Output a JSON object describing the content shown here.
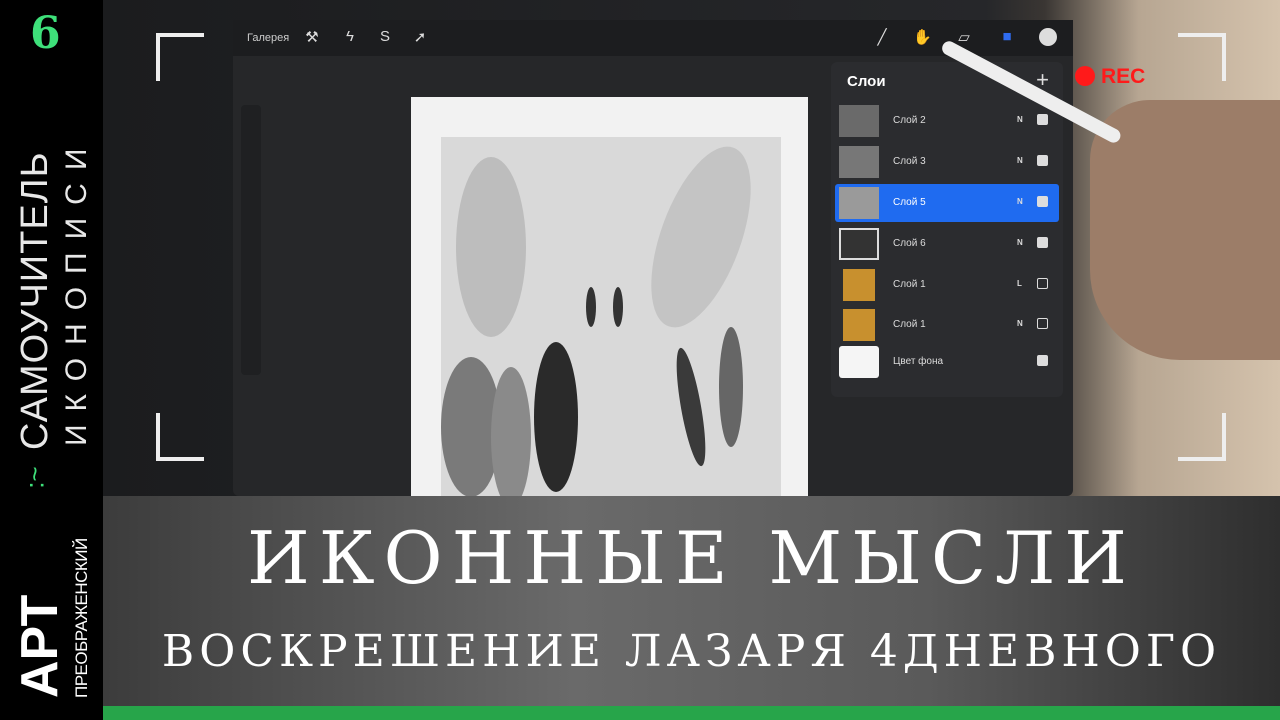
{
  "sidebar": {
    "episode_number": "6",
    "series_title_line1": "САМОУЧИТЕЛЬ",
    "series_title_line2": "ИКОНОПИСИ",
    "brand_main": "АРТ",
    "brand_sub": "ПРЕОБРАЖЕНСКИЙ",
    "accent_color": "#3ee07a"
  },
  "procreate": {
    "gallery_label": "Галерея",
    "layers_panel": {
      "title": "Слои",
      "add_label": "+",
      "layers": [
        {
          "name": "Слой 2",
          "mode": "N",
          "visible": true,
          "selected": false
        },
        {
          "name": "Слой 3",
          "mode": "N",
          "visible": true,
          "selected": false
        },
        {
          "name": "Слой 5",
          "mode": "N",
          "visible": true,
          "selected": true
        },
        {
          "name": "Слой 6",
          "mode": "N",
          "visible": true,
          "selected": false
        },
        {
          "name": "Слой 1",
          "mode": "L",
          "visible": false,
          "selected": false
        },
        {
          "name": "Слой 1",
          "mode": "N",
          "visible": false,
          "selected": false
        }
      ],
      "background_layer": {
        "name": "Цвет фона",
        "visible": true
      }
    }
  },
  "overlay": {
    "rec_label": "REC",
    "rec_color": "#ff1a1a"
  },
  "title": {
    "main": "ИКОННЫЕ МЫСЛИ",
    "subtitle": "ВОСКРЕШЕНИЕ ЛАЗАРЯ 4ДНЕВНОГО"
  }
}
